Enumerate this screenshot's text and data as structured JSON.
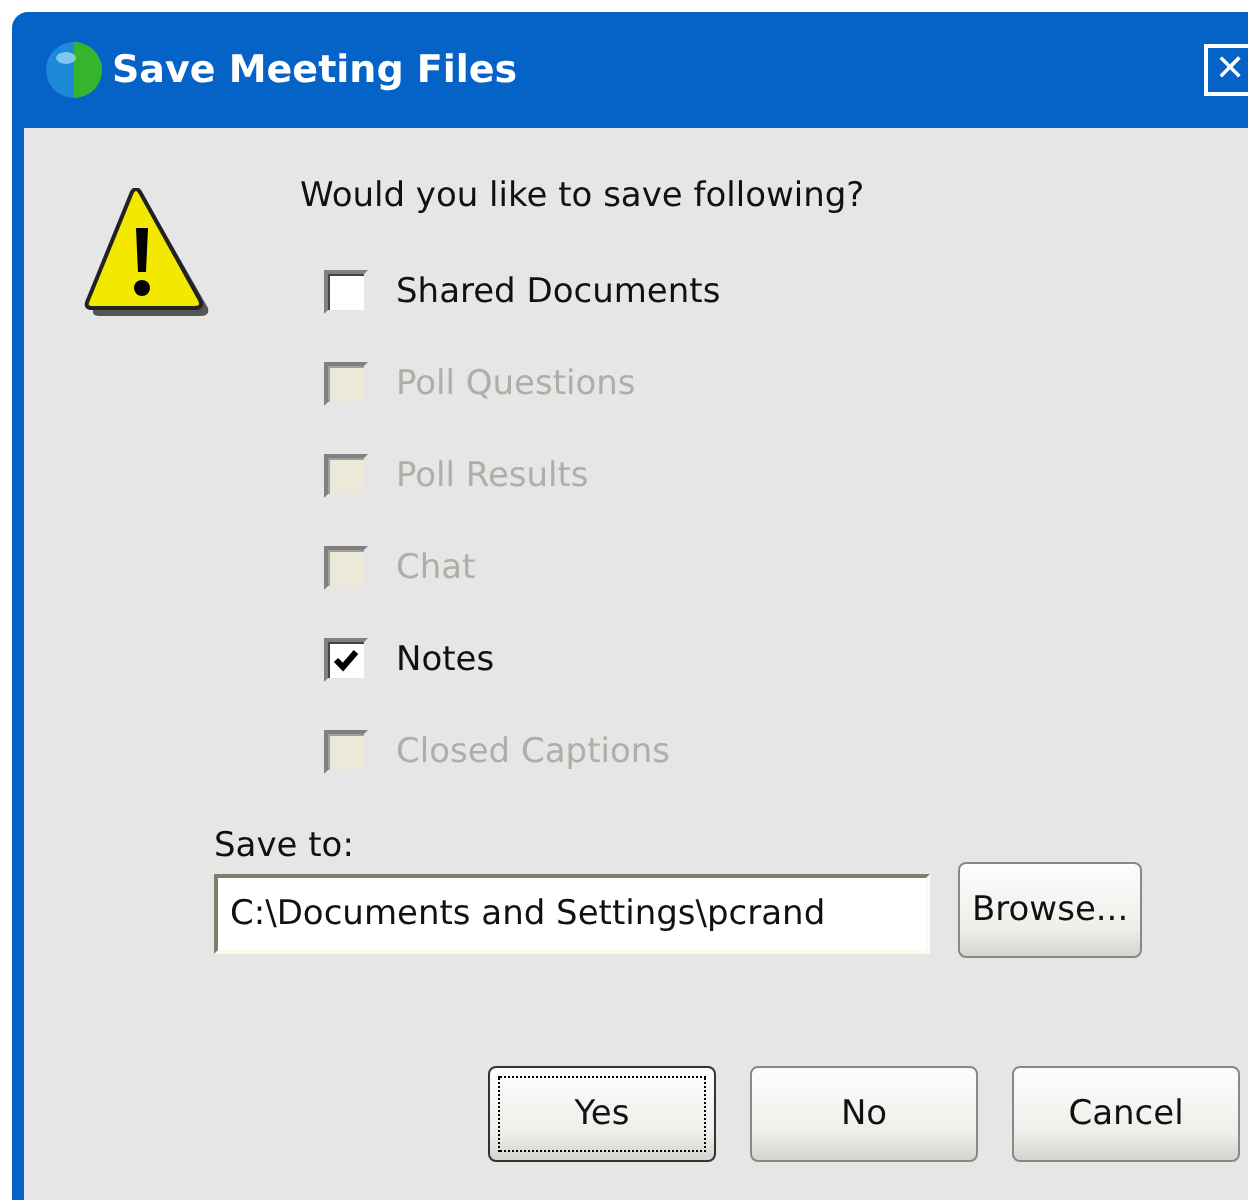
{
  "window": {
    "title": "Save Meeting Files",
    "close": "✕"
  },
  "question": "Would you like to save following?",
  "options": [
    {
      "label": "Shared Documents",
      "checked": false,
      "disabled": false
    },
    {
      "label": "Poll Questions",
      "checked": false,
      "disabled": true
    },
    {
      "label": "Poll Results",
      "checked": false,
      "disabled": true
    },
    {
      "label": "Chat",
      "checked": false,
      "disabled": true
    },
    {
      "label": "Notes",
      "checked": true,
      "disabled": false
    },
    {
      "label": "Closed Captions",
      "checked": false,
      "disabled": true
    }
  ],
  "save_to": {
    "label": "Save to:",
    "value": "C:\\Documents and Settings\\pcrand",
    "browse": "Browse..."
  },
  "buttons": [
    {
      "label": "Yes",
      "focused": true
    },
    {
      "label": "No",
      "focused": false
    },
    {
      "label": "Cancel",
      "focused": false
    }
  ]
}
